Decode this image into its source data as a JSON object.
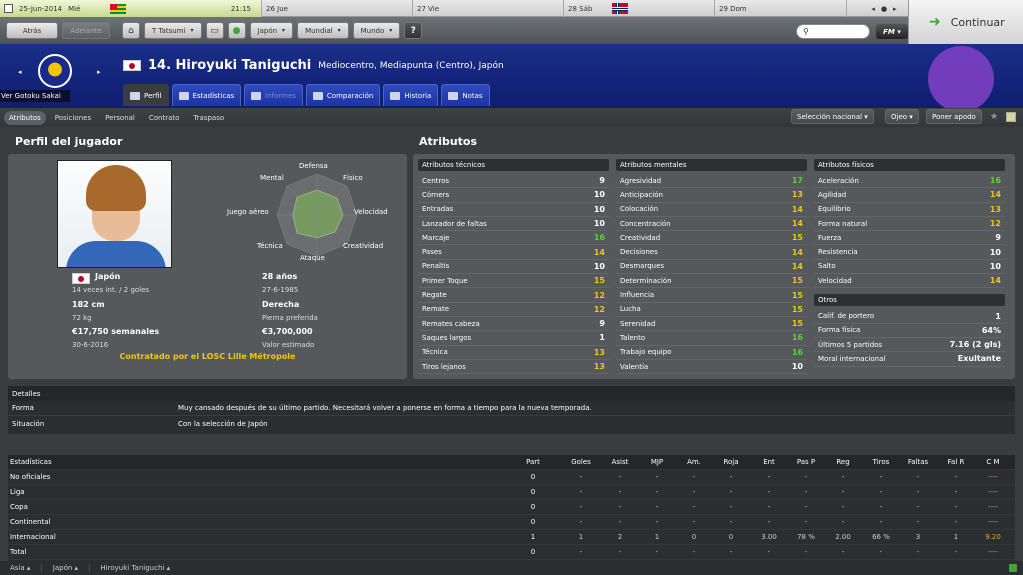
{
  "calendar": {
    "today_date": "25-Jun-2014",
    "today_weekday": "Mié",
    "time": "21:15",
    "days": [
      "26 Jue",
      "27 Vie",
      "28 Sáb",
      "29 Dom"
    ]
  },
  "continue_label": "Continuar",
  "toolbar": {
    "back": "Atrás",
    "forward": "Adelante",
    "manager": "T Tatsumi",
    "nation": "Japón",
    "competition": "Mundial",
    "world": "Mundo",
    "fm": "FM"
  },
  "club": {
    "label": "Ver Gotoku Sakai"
  },
  "player": {
    "number_name": "14. Hiroyuki Taniguchi",
    "positions": "Mediocentro, Mediapunta (Centro), Japón"
  },
  "tabs": [
    "Perfil",
    "Estadísticas",
    "Informes",
    "Comparación",
    "Historia",
    "Notas"
  ],
  "subtabs": [
    "Atributos",
    "Posiciones",
    "Personal",
    "Contrato",
    "Traspaso"
  ],
  "right_buttons": {
    "national": "Selección nacional",
    "scout": "Ojeo",
    "interest": "Poner apodo"
  },
  "profile": {
    "title": "Perfil del jugador",
    "radar": {
      "top": "Defensa",
      "tl": "Mental",
      "tr": "Físico",
      "l": "Juego aéreo",
      "r": "Velocidad",
      "bl": "Técnica",
      "br": "Creatividad",
      "bottom": "Ataque"
    },
    "nation": "Japón",
    "caps": "14 veces int. / 2 goles",
    "age": "28 años",
    "dob": "27-6-1985",
    "height": "182 cm",
    "weight": "72 kg",
    "foot": "Derecha",
    "foot_label": "Pierna preferida",
    "wage": "€17,750 semanales",
    "contract_end": "30-6-2016",
    "value": "€3,700,000",
    "value_label": "Valor estimado",
    "contract": "Contratado por el LOSC Lille Métropole"
  },
  "attributes": {
    "title": "Atributos",
    "technical_head": "Atributos técnicos",
    "technical": [
      {
        "n": "Centros",
        "v": "9"
      },
      {
        "n": "Córners",
        "v": "10"
      },
      {
        "n": "Entradas",
        "v": "10"
      },
      {
        "n": "Lanzador de faltas",
        "v": "10"
      },
      {
        "n": "Marcaje",
        "v": "16"
      },
      {
        "n": "Pases",
        "v": "14"
      },
      {
        "n": "Penaltis",
        "v": "10"
      },
      {
        "n": "Primer Toque",
        "v": "15"
      },
      {
        "n": "Regate",
        "v": "12"
      },
      {
        "n": "Remate",
        "v": "12"
      },
      {
        "n": "Remates cabeza",
        "v": "9"
      },
      {
        "n": "Saques largos",
        "v": "1"
      },
      {
        "n": "Técnica",
        "v": "13"
      },
      {
        "n": "Tiros lejanos",
        "v": "13"
      }
    ],
    "mental_head": "Atributos mentales",
    "mental": [
      {
        "n": "Agresividad",
        "v": "17"
      },
      {
        "n": "Anticipación",
        "v": "13"
      },
      {
        "n": "Colocación",
        "v": "14"
      },
      {
        "n": "Concentración",
        "v": "14"
      },
      {
        "n": "Creatividad",
        "v": "15"
      },
      {
        "n": "Decisiones",
        "v": "14"
      },
      {
        "n": "Desmarques",
        "v": "14"
      },
      {
        "n": "Determinación",
        "v": "15"
      },
      {
        "n": "Influencia",
        "v": "15"
      },
      {
        "n": "Lucha",
        "v": "15"
      },
      {
        "n": "Serenidad",
        "v": "15"
      },
      {
        "n": "Talento",
        "v": "16"
      },
      {
        "n": "Trabajo equipo",
        "v": "16"
      },
      {
        "n": "Valentía",
        "v": "10"
      }
    ],
    "physical_head": "Atributos físicos",
    "physical": [
      {
        "n": "Aceleración",
        "v": "16"
      },
      {
        "n": "Agilidad",
        "v": "14"
      },
      {
        "n": "Equilibrio",
        "v": "13"
      },
      {
        "n": "Forma natural",
        "v": "12"
      },
      {
        "n": "Fuerza",
        "v": "9"
      },
      {
        "n": "Resistencia",
        "v": "10"
      },
      {
        "n": "Salto",
        "v": "10"
      },
      {
        "n": "Velocidad",
        "v": "14"
      }
    ],
    "other_head": "Otros",
    "other": [
      {
        "n": "Calif. de portero",
        "v": "1"
      },
      {
        "n": "Forma física",
        "v": "64%"
      },
      {
        "n": "Últimos 5 partidos",
        "v": "7.16 (2 gls)"
      },
      {
        "n": "Moral internacional",
        "v": "Exultante"
      }
    ]
  },
  "details": {
    "title": "Detalles",
    "rows": [
      {
        "label": "Forma",
        "value": "Muy cansado después de su último partido. Necesitará volver a ponerse en forma a tiempo para la nueva temporada."
      },
      {
        "label": "Situación",
        "value": "Con la selección de Japón"
      }
    ]
  },
  "stats": {
    "title": "Estadísticas",
    "columns": [
      "Part",
      "Goles",
      "Asist",
      "MJP",
      "Am.",
      "Roja",
      "Ent",
      "Pas P",
      "Reg",
      "Tiros",
      "Faltas",
      "Fal R",
      "C M"
    ],
    "rows": [
      {
        "label": "No oficiales",
        "cells": [
          "0",
          "-",
          "-",
          "-",
          "-",
          "-",
          "-",
          "-",
          "-",
          "-",
          "-",
          "-",
          "----"
        ]
      },
      {
        "label": "Liga",
        "cells": [
          "0",
          "-",
          "-",
          "-",
          "-",
          "-",
          "-",
          "-",
          "-",
          "-",
          "-",
          "-",
          "----"
        ]
      },
      {
        "label": "Copa",
        "cells": [
          "0",
          "-",
          "-",
          "-",
          "-",
          "-",
          "-",
          "-",
          "-",
          "-",
          "-",
          "-",
          "----"
        ]
      },
      {
        "label": "Continental",
        "cells": [
          "0",
          "-",
          "-",
          "-",
          "-",
          "-",
          "-",
          "-",
          "-",
          "-",
          "-",
          "-",
          "----"
        ]
      },
      {
        "label": "Internacional",
        "cells": [
          "1",
          "1",
          "2",
          "1",
          "0",
          "0",
          "3.00",
          "78 %",
          "2.00",
          "66 %",
          "3",
          "1",
          "9.20"
        ]
      },
      {
        "label": "Total",
        "cells": [
          "0",
          "-",
          "-",
          "-",
          "-",
          "-",
          "-",
          "-",
          "-",
          "-",
          "-",
          "-",
          "----"
        ]
      }
    ]
  },
  "footer": [
    "Asia",
    "Japón",
    "Hiroyuki Taniguchi"
  ]
}
